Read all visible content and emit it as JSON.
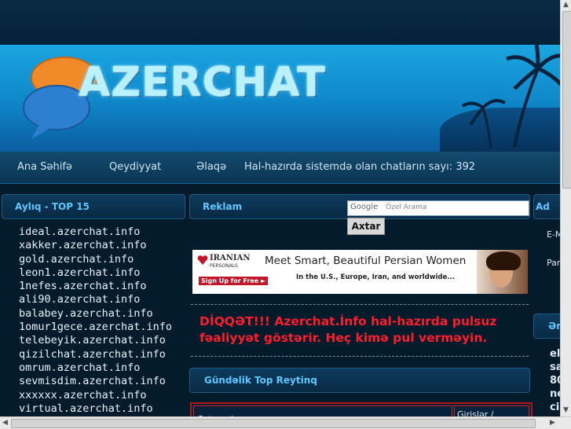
{
  "site": {
    "logo_text": "AZERCHAT"
  },
  "nav": {
    "home": "Ana Səhifə",
    "register": "Qeydiyyat",
    "contact": "Əlaqə",
    "online_count": "Hal-hazırda sistemdə olan chatların sayı: 392"
  },
  "left": {
    "title": "Aylıq - TOP 15",
    "items": [
      "ideal.azerchat.info",
      "xakker.azerchat.info",
      "gold.azerchat.info",
      "leon1.azerchat.info",
      "1nefes.azerchat.info",
      "ali90.azerchat.info",
      "balabey.azerchat.info",
      "1omur1gece.azerchat.info",
      "telebeyik.azerchat.info",
      "qizilchat.azerchat.info",
      "omrum.azerchat.info",
      "sevmisdim.azerchat.info",
      "xxxxxx.azerchat.info",
      "virtual.azerchat.info"
    ]
  },
  "center": {
    "reklam_title": "Reklam",
    "search_logo": "Google",
    "search_placeholder": "Özel Arama",
    "search_button": "Axtar",
    "ad": {
      "brand_top": "IRANIAN",
      "brand_bottom": "PERSONALS",
      "signup": "Sign Up for Free ►",
      "headline": "Meet Smart, Beautiful Persian Women",
      "subline": "In the U.S., Europe, Iran, and worldwide..."
    },
    "warning": "DİQQƏT!!! Azerchat.İnfo hal-hazırda pulsuz fəaliyyət göstərir. Heç kimə pul verməyin.",
    "rating_title": "Gündəlik Top Reytinq",
    "table_headers": [
      "Çatın adı",
      "Girişlər /"
    ]
  },
  "right": {
    "head1": "Ad",
    "email": "E-M",
    "pass": "Par",
    "head2": "Əm",
    "lines": [
      "el",
      "sa",
      "80",
      "ne",
      "ci"
    ]
  },
  "colors": {
    "accent": "#5ec7ff",
    "warning": "#ff1d2b"
  }
}
